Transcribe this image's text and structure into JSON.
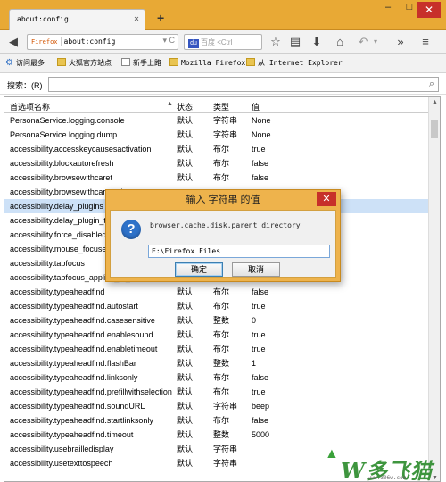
{
  "window": {
    "tab_title": "about:config",
    "tab_close": "×",
    "new_tab": "+",
    "min": "–",
    "max": "□",
    "close": "✕"
  },
  "nav": {
    "identity": "Firefox",
    "url": "about:config",
    "url_tools": "▾ C",
    "search_placeholder": "百度 <Ctrl",
    "search_engine": "du"
  },
  "bookmarks": [
    {
      "label": "访问最多",
      "icon": "gear-icon"
    },
    {
      "label": "火狐官方站点",
      "icon": "folder-icon"
    },
    {
      "label": "新手上路",
      "icon": "page-icon"
    },
    {
      "label": "Mozilla Firefox",
      "icon": "folder-icon"
    },
    {
      "label": "从 Internet Explorer",
      "icon": "folder-icon"
    }
  ],
  "filter": {
    "label": "搜索：(R)",
    "value": ""
  },
  "table": {
    "headers": {
      "name": "首选项名称",
      "status": "状态",
      "type": "类型",
      "value": "值"
    },
    "rows": [
      {
        "name": "PersonaService.logging.console",
        "status": "默认",
        "type": "字符串",
        "value": "None"
      },
      {
        "name": "PersonaService.logging.dump",
        "status": "默认",
        "type": "字符串",
        "value": "None"
      },
      {
        "name": "accessibility.accesskeycausesactivation",
        "status": "默认",
        "type": "布尔",
        "value": "true"
      },
      {
        "name": "accessibility.blockautorefresh",
        "status": "默认",
        "type": "布尔",
        "value": "false"
      },
      {
        "name": "accessibility.browsewithcaret",
        "status": "默认",
        "type": "布尔",
        "value": "false"
      },
      {
        "name": "accessibility.browsewithcaret_shortcut",
        "status": "",
        "type": "",
        "value": ""
      },
      {
        "name": "accessibility.delay_plugins",
        "status": "",
        "type": "",
        "value": "",
        "selected": true
      },
      {
        "name": "accessibility.delay_plugin_time",
        "status": "",
        "type": "",
        "value": ""
      },
      {
        "name": "accessibility.force_disabled",
        "status": "",
        "type": "",
        "value": ""
      },
      {
        "name": "accessibility.mouse_focuses_formcontrol",
        "status": "",
        "type": "",
        "value": ""
      },
      {
        "name": "accessibility.tabfocus",
        "status": "",
        "type": "",
        "value": ""
      },
      {
        "name": "accessibility.tabfocus_applies_to_xul",
        "status": "",
        "type": "",
        "value": ""
      },
      {
        "name": "accessibility.typeaheadfind",
        "status": "默认",
        "type": "布尔",
        "value": "false"
      },
      {
        "name": "accessibility.typeaheadfind.autostart",
        "status": "默认",
        "type": "布尔",
        "value": "true"
      },
      {
        "name": "accessibility.typeaheadfind.casesensitive",
        "status": "默认",
        "type": "整数",
        "value": "0"
      },
      {
        "name": "accessibility.typeaheadfind.enablesound",
        "status": "默认",
        "type": "布尔",
        "value": "true"
      },
      {
        "name": "accessibility.typeaheadfind.enabletimeout",
        "status": "默认",
        "type": "布尔",
        "value": "true"
      },
      {
        "name": "accessibility.typeaheadfind.flashBar",
        "status": "默认",
        "type": "整数",
        "value": "1"
      },
      {
        "name": "accessibility.typeaheadfind.linksonly",
        "status": "默认",
        "type": "布尔",
        "value": "false"
      },
      {
        "name": "accessibility.typeaheadfind.prefillwithselection",
        "status": "默认",
        "type": "布尔",
        "value": "true"
      },
      {
        "name": "accessibility.typeaheadfind.soundURL",
        "status": "默认",
        "type": "字符串",
        "value": "beep"
      },
      {
        "name": "accessibility.typeaheadfind.startlinksonly",
        "status": "默认",
        "type": "布尔",
        "value": "false"
      },
      {
        "name": "accessibility.typeaheadfind.timeout",
        "status": "默认",
        "type": "整数",
        "value": "5000"
      },
      {
        "name": "accessibility.usebrailledisplay",
        "status": "默认",
        "type": "字符串",
        "value": ""
      },
      {
        "name": "accessibility.usetexttospeech",
        "status": "默认",
        "type": "字符串",
        "value": ""
      }
    ]
  },
  "dialog": {
    "title": "输入 字符串 的值",
    "close": "✕",
    "icon": "?",
    "label": "browser.cache.disk.parent_directory",
    "input_value": "E:\\Firefox Files",
    "ok": "确定",
    "cancel": "取消"
  },
  "watermark": {
    "text": "W多飞猫",
    "url": "www.306w.com"
  }
}
